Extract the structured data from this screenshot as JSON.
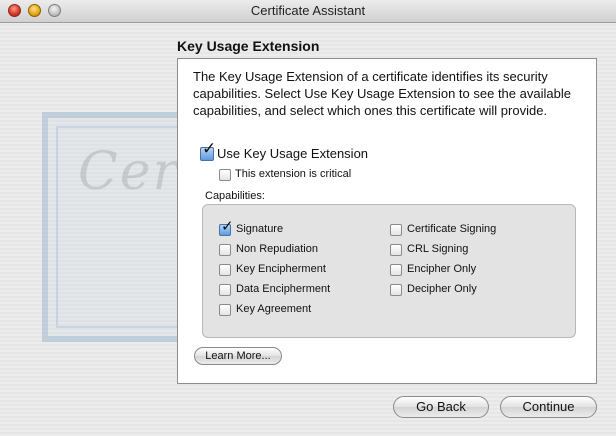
{
  "window": {
    "title": "Certificate Assistant"
  },
  "watermark": {
    "script_text": "Certif"
  },
  "section": {
    "title": "Key Usage Extension"
  },
  "panel": {
    "description": "The Key Usage Extension of a certificate identifies its security capabilities. Select Use Key Usage Extension to see the available capabilities, and select which ones this certificate will provide.",
    "use_extension": {
      "label": "Use Key Usage Extension",
      "checked": true
    },
    "critical": {
      "label": "This extension is critical",
      "checked": false
    },
    "capabilities_label": "Capabilities:",
    "capabilities_left": [
      {
        "label": "Signature",
        "checked": true
      },
      {
        "label": "Non Repudiation",
        "checked": false
      },
      {
        "label": "Key Encipherment",
        "checked": false
      },
      {
        "label": "Data Encipherment",
        "checked": false
      },
      {
        "label": "Key Agreement",
        "checked": false
      }
    ],
    "capabilities_right": [
      {
        "label": "Certificate Signing",
        "checked": false
      },
      {
        "label": "CRL Signing",
        "checked": false
      },
      {
        "label": "Encipher Only",
        "checked": false
      },
      {
        "label": "Decipher Only",
        "checked": false
      }
    ],
    "learn_more_label": "Learn More..."
  },
  "buttons": {
    "back_label": "Go Back",
    "continue_label": "Continue"
  }
}
